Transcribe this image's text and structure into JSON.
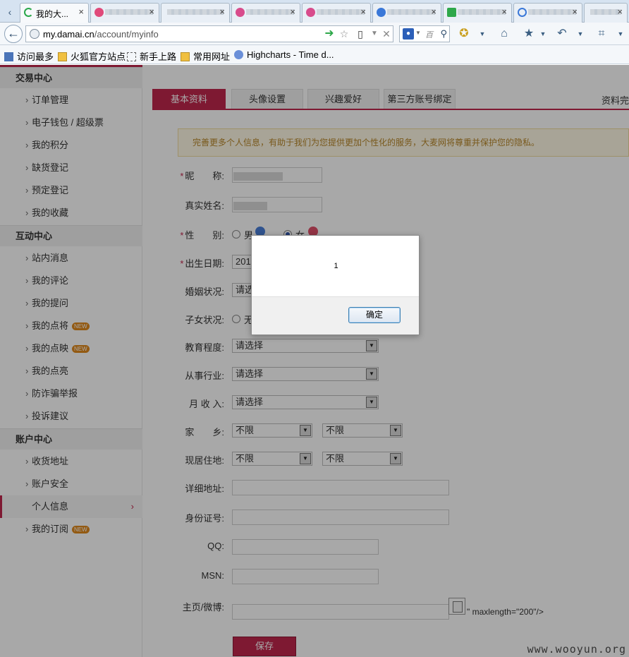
{
  "browser": {
    "tabs": [
      {
        "label": "我的大...",
        "close": "×",
        "active": true
      },
      {
        "label": "",
        "close": "×"
      },
      {
        "label": "",
        "close": "×"
      },
      {
        "label": "",
        "close": "×"
      },
      {
        "label": "",
        "close": "×"
      },
      {
        "label": "",
        "close": "×"
      },
      {
        "label": "",
        "close": "×"
      },
      {
        "label": "",
        "close": "×"
      },
      {
        "label": "",
        "close": "×"
      }
    ],
    "url_domain": "my.damai.cn",
    "url_path": "/account/myinfo",
    "bookmarks": [
      {
        "label": "访问最多"
      },
      {
        "label": "火狐官方站点"
      },
      {
        "label": "新手上路"
      },
      {
        "label": "常用网址"
      },
      {
        "label": "Highcharts - Time d..."
      }
    ],
    "colors": {
      "accent": "#c0274d",
      "notice_text": "#b8872a"
    }
  },
  "sidebar": {
    "sections": [
      {
        "title": "交易中心",
        "items": [
          "订单管理",
          "电子钱包 / 超级票",
          "我的积分",
          "缺货登记",
          "预定登记",
          "我的收藏"
        ]
      },
      {
        "title": "互动中心",
        "items": [
          "站内消息",
          "我的评论",
          "我的提问",
          "我的点将",
          "我的点映",
          "我的点亮",
          "防诈骗举报",
          "投诉建议"
        ]
      },
      {
        "title": "账户中心",
        "items": [
          "收货地址",
          "账户安全",
          "个人信息",
          "我的订阅"
        ]
      }
    ],
    "new_badge": "NEW",
    "chevron": "›"
  },
  "main": {
    "tabs": [
      "基本资料",
      "头像设置",
      "兴趣爱好",
      "第三方账号绑定"
    ],
    "profile_status": "资料完",
    "notice": "完善更多个人信息，有助于我们为您提供更加个性化的服务，大麦网将尊重并保护您的隐私。",
    "form": {
      "nickname_label": "昵　　称:",
      "realname_label": "真实姓名:",
      "gender_label": "性　　别:",
      "gender_male": "男",
      "gender_female": "女",
      "birthday_label": "出生日期:",
      "birthday_value": "201",
      "marital_label": "婚姻状况:",
      "marital_value": "请选",
      "children_label": "子女状况:",
      "children_value": "无",
      "education_label": "教育程度:",
      "education_value": "请选择",
      "industry_label": "从事行业:",
      "industry_value": "请选择",
      "income_label": "月 收 入:",
      "income_value": "请选择",
      "hometown_label": "家　　乡:",
      "hometown_province": "不限",
      "hometown_city": "不限",
      "residence_label": "现居住地:",
      "residence_province": "不限",
      "residence_city": "不限",
      "address_label": "详细地址:",
      "idcard_label": "身份证号:",
      "qq_label": "QQ:",
      "msn_label": "MSN:",
      "homepage_label": "主页/微博:",
      "code_tail": "\" maxlength=\"200\"/>",
      "save_label": "保存"
    }
  },
  "dialog": {
    "message": "1",
    "ok_label": "确定"
  },
  "watermark": "www.wooyun.org"
}
